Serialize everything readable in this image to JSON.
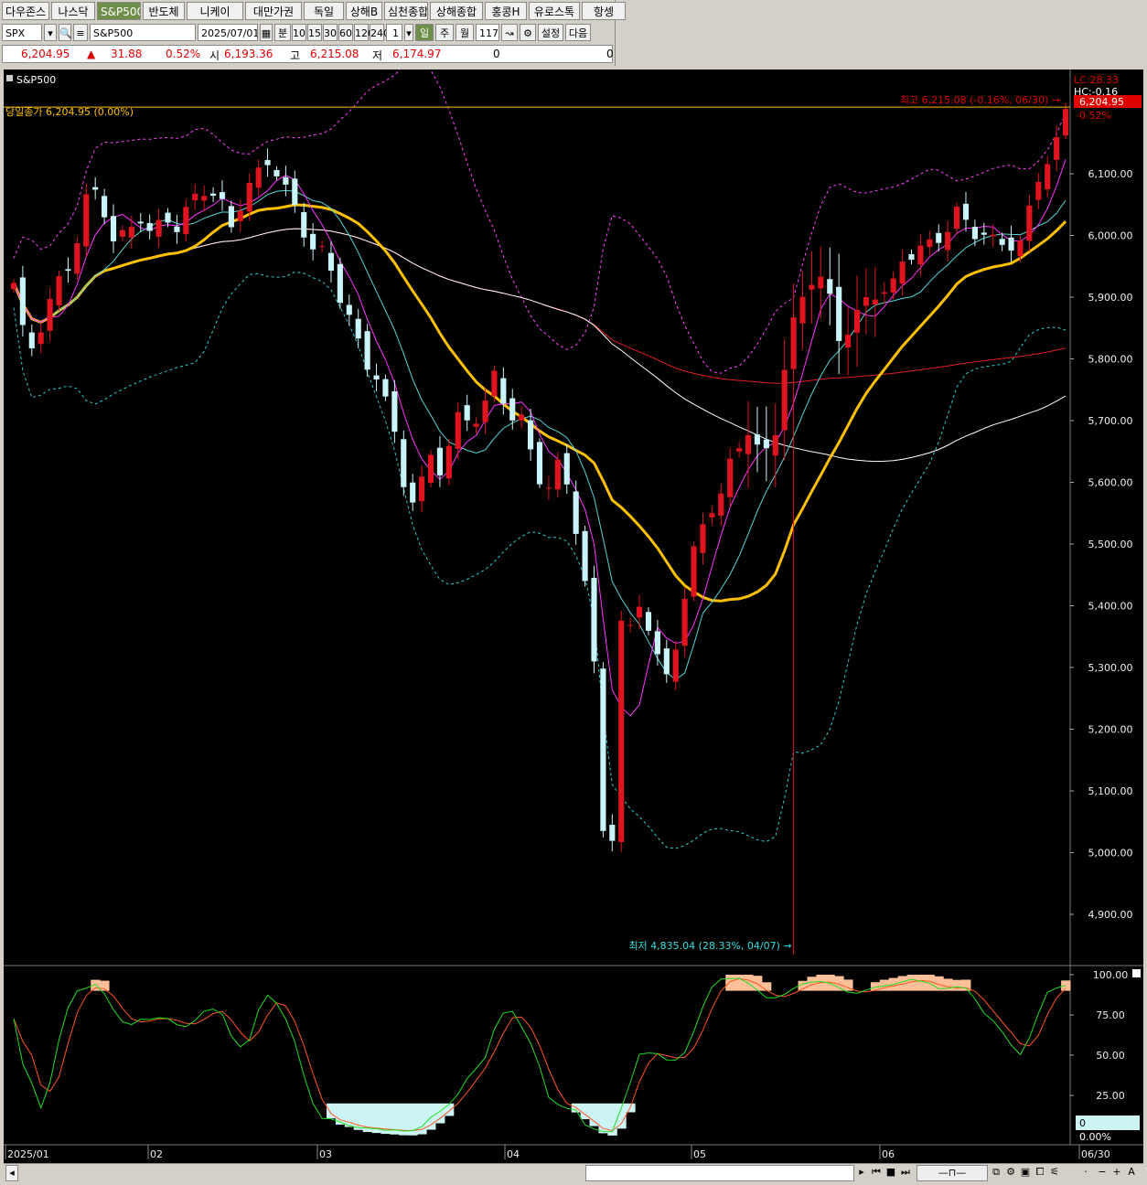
{
  "tabs": [
    "다우존스",
    "나스닥",
    "S&P500",
    "반도체",
    "니케이",
    "대만가권",
    "독일",
    "상해B",
    "심천종합",
    "상해종합",
    "홍콩H",
    "유로스톡",
    "항셍"
  ],
  "active_tab": 2,
  "symbol": {
    "code": "SPX",
    "name": "S&P500",
    "date": "2025/07/01",
    "count": "1",
    "bars": "117"
  },
  "intervals": [
    "분",
    "10",
    "15",
    "30",
    "60",
    "120",
    "240"
  ],
  "periods": [
    "일",
    "주",
    "월"
  ],
  "active_period": "일",
  "buttons": {
    "settings": "설정",
    "next": "다음"
  },
  "quote": {
    "price": "6,204.95",
    "change_arrow": "▲",
    "change": "31.88",
    "pct": "0.52%",
    "open_label": "시",
    "open": "6,193.36",
    "high_label": "고",
    "high": "6,215.08",
    "low_label": "저",
    "low": "6,174.97",
    "vol1": "0",
    "vol2": "0"
  },
  "chart": {
    "title": "S&P500",
    "prev_close_label": "당일종가 6,204.95 (0.00%)",
    "high_note": "최고 6,215.08 (-0.16%, 06/30)",
    "low_note": "최저 4,835.04 (28.33%, 04/07)",
    "lc": "LC:28.33",
    "hc": "HC:-0.16",
    "price_tag": "6,204.95",
    "pct_tag": "0.52%",
    "y_ticks": [
      "6,100.00",
      "6,000.00",
      "5,900.00",
      "5,800.00",
      "5,700.00",
      "5,600.00",
      "5,500.00",
      "5,400.00",
      "5,300.00",
      "5,200.00",
      "5,100.00",
      "5,000.00",
      "4,900.00"
    ],
    "osc_ticks": [
      "100.00",
      "75.00",
      "50.00",
      "25.00"
    ],
    "osc_box_value": "0",
    "osc_box_pct": "0.00%",
    "x_labels": [
      "2025/01",
      "02",
      "03",
      "04",
      "05",
      "06",
      "06/30"
    ]
  },
  "chart_data": {
    "type": "candlestick",
    "ylim": [
      4820,
      6260
    ],
    "osc_ylim": [
      0,
      100
    ],
    "n_bars": 117,
    "colors": {
      "up": "#e0141e",
      "down": "#c8f4fa",
      "ma5": "#ff33ff",
      "ma10": "#55d6d6",
      "ma20": "#ffc000",
      "ma60": "#ffffff",
      "ma120": "#e02020",
      "bb": "#ff44ff",
      "bb_low": "#33cccc",
      "stoch_k": "#22dd22",
      "stoch_d": "#ff5522"
    },
    "anchors": [
      [
        0,
        5915
      ],
      [
        2,
        5800
      ],
      [
        4,
        5860
      ],
      [
        6,
        5910
      ],
      [
        9,
        5960
      ],
      [
        11,
        6050
      ],
      [
        13,
        6080
      ],
      [
        15,
        6000
      ],
      [
        17,
        5995
      ],
      [
        19,
        6030
      ],
      [
        21,
        5990
      ],
      [
        23,
        6040
      ],
      [
        25,
        6020
      ],
      [
        27,
        6050
      ],
      [
        29,
        6070
      ],
      [
        31,
        6060
      ],
      [
        33,
        6020
      ],
      [
        35,
        6080
      ],
      [
        37,
        6090
      ],
      [
        39,
        6120
      ],
      [
        41,
        6080
      ],
      [
        43,
        6040
      ],
      [
        45,
        5990
      ],
      [
        47,
        5960
      ],
      [
        49,
        5910
      ],
      [
        51,
        5870
      ],
      [
        53,
        5800
      ],
      [
        55,
        5780
      ],
      [
        57,
        5700
      ],
      [
        59,
        5600
      ],
      [
        61,
        5570
      ],
      [
        63,
        5650
      ],
      [
        65,
        5620
      ],
      [
        67,
        5690
      ],
      [
        69,
        5700
      ],
      [
        71,
        5720
      ],
      [
        73,
        5780
      ],
      [
        75,
        5710
      ],
      [
        77,
        5690
      ],
      [
        79,
        5620
      ],
      [
        81,
        5600
      ],
      [
        83,
        5640
      ],
      [
        85,
        5540
      ],
      [
        87,
        5400
      ],
      [
        88,
        5290
      ],
      [
        89,
        5080
      ],
      [
        90,
        4980
      ],
      [
        91,
        5060
      ],
      [
        92,
        5380
      ],
      [
        93,
        5300
      ],
      [
        94,
        5430
      ],
      [
        96,
        5370
      ],
      [
        97,
        5310
      ],
      [
        99,
        5290
      ],
      [
        101,
        5380
      ],
      [
        103,
        5480
      ],
      [
        105,
        5550
      ],
      [
        107,
        5560
      ],
      [
        109,
        5650
      ],
      [
        111,
        5700
      ],
      [
        113,
        5640
      ],
      [
        115,
        5650
      ],
      [
        117,
        5790
      ],
      [
        119,
        5900
      ],
      [
        121,
        5940
      ],
      [
        123,
        5920
      ],
      [
        125,
        5830
      ],
      [
        127,
        5850
      ],
      [
        129,
        5900
      ],
      [
        131,
        5920
      ],
      [
        133,
        5900
      ],
      [
        135,
        5960
      ],
      [
        137,
        5980
      ],
      [
        139,
        5990
      ],
      [
        141,
        6010
      ],
      [
        143,
        6030
      ],
      [
        145,
        6000
      ],
      [
        147,
        6010
      ],
      [
        149,
        5990
      ],
      [
        151,
        5990
      ],
      [
        153,
        5980
      ],
      [
        155,
        6080
      ],
      [
        157,
        6140
      ],
      [
        159,
        6173
      ],
      [
        160,
        6205
      ]
    ],
    "anchor_scale": 0.7275,
    "low_point": {
      "index": 86,
      "value": 4835.04
    },
    "high_point": {
      "index": 116,
      "value": 6215.08
    }
  }
}
